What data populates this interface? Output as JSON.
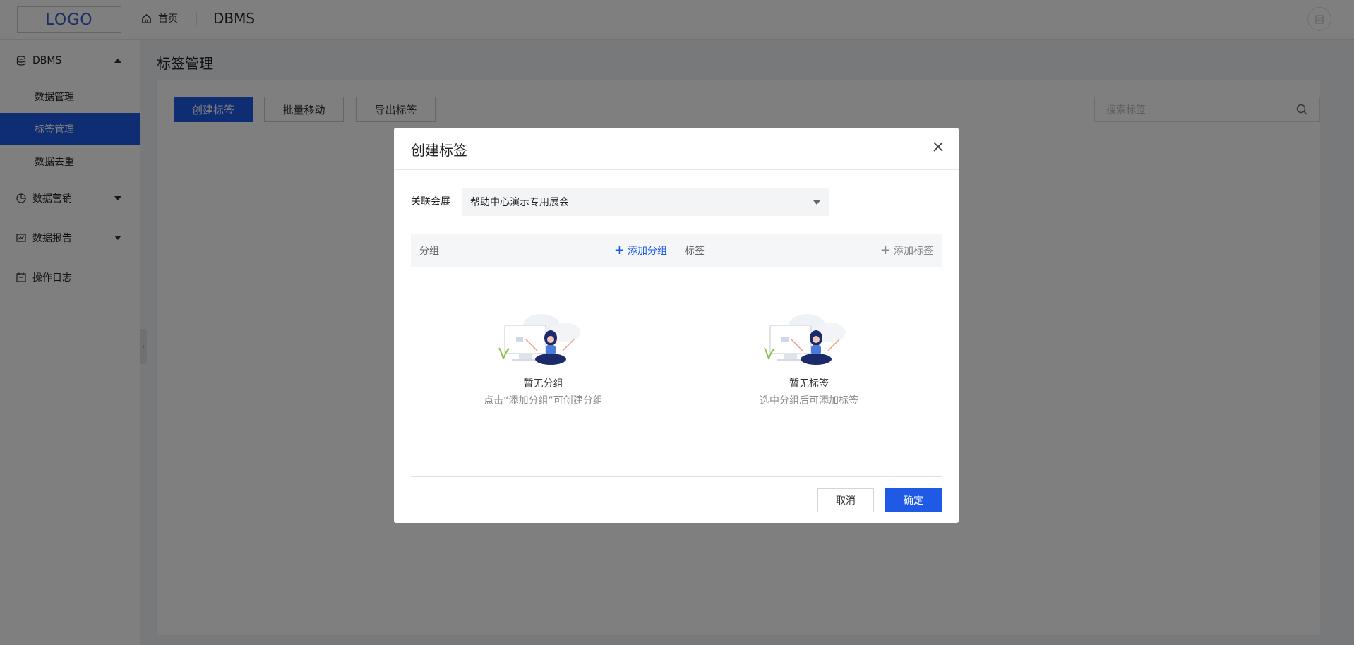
{
  "header": {
    "logo": "LOGO",
    "home": "首页",
    "system": "DBMS"
  },
  "sidebar": {
    "groups": [
      {
        "label": "DBMS",
        "icon": "database-icon",
        "expanded": true
      },
      {
        "label": "数据营销",
        "icon": "pie-chart-icon",
        "expanded": false
      },
      {
        "label": "数据报告",
        "icon": "line-chart-icon",
        "expanded": false
      },
      {
        "label": "操作日志",
        "icon": "calendar-icon"
      }
    ],
    "sub_items": [
      "数据管理",
      "标签管理",
      "数据去重"
    ],
    "active": "标签管理"
  },
  "page": {
    "title": "标签管理",
    "toolbar": {
      "create": "创建标签",
      "batch_move": "批量移动",
      "export": "导出标签"
    },
    "search_placeholder": "搜索标签"
  },
  "modal": {
    "title": "创建标签",
    "field_label": "关联会展",
    "field_value": "帮助中心演示专用展会",
    "left_panel": {
      "header": "分组",
      "add": "添加分组",
      "empty_title": "暂无分组",
      "empty_hint": "点击“添加分组”可创建分组"
    },
    "right_panel": {
      "header": "标签",
      "add": "添加标签",
      "empty_title": "暂无标签",
      "empty_hint": "选中分组后可添加标签"
    },
    "cancel": "取消",
    "confirm": "确定"
  },
  "colors": {
    "primary": "#1e5ae6",
    "mask": "rgba(0,0,0,0.5)"
  }
}
